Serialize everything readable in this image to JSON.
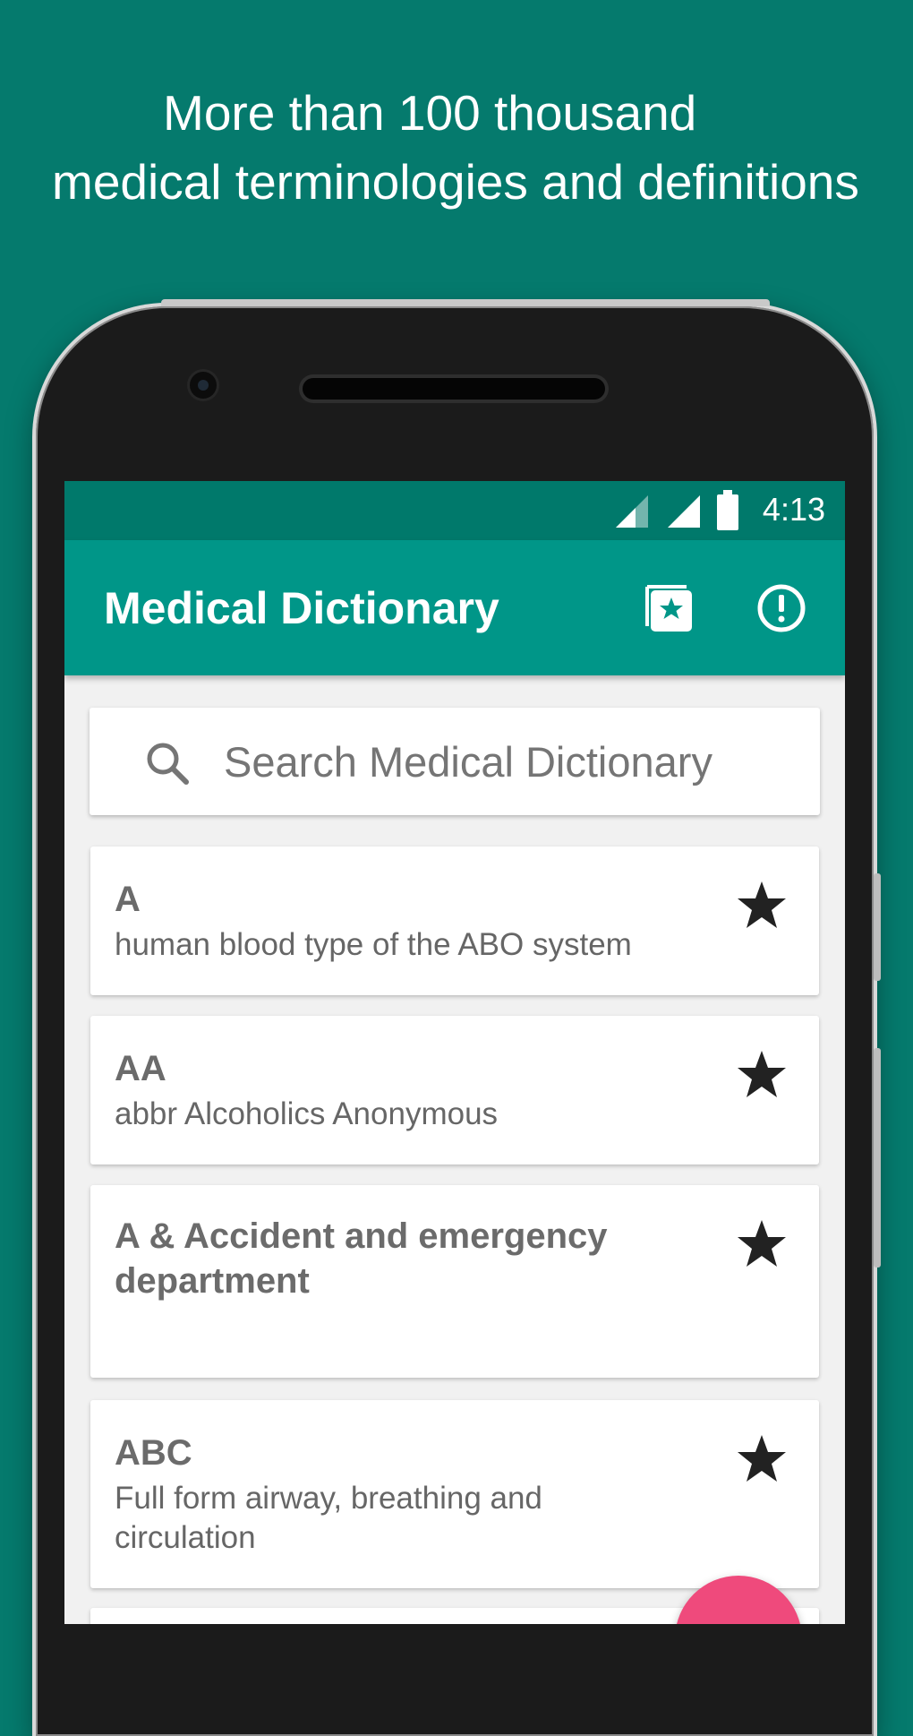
{
  "promo": {
    "line1": "More than 100 thousand",
    "line2": "medical terminologies and definitions"
  },
  "status_bar": {
    "time": "4:13",
    "icons": [
      "signal-icon",
      "signal-icon",
      "battery-icon"
    ]
  },
  "app_bar": {
    "title": "Medical Dictionary",
    "actions": [
      "favorites-icon",
      "info-icon"
    ]
  },
  "search": {
    "placeholder": "Search Medical Dictionary",
    "value": ""
  },
  "entries": [
    {
      "term": "A",
      "definition": "human blood type of the ABO system"
    },
    {
      "term": "AA",
      "definition": "abbr Alcoholics Anonymous"
    },
    {
      "term": "A & Accident and emergency department",
      "definition": ""
    },
    {
      "term": "ABC",
      "definition": "Full form airway, breathing and circulation"
    }
  ],
  "colors": {
    "background": "#057a6d",
    "status_bar": "#00796b",
    "app_bar": "#009688",
    "fab": "#ef4a7c"
  }
}
